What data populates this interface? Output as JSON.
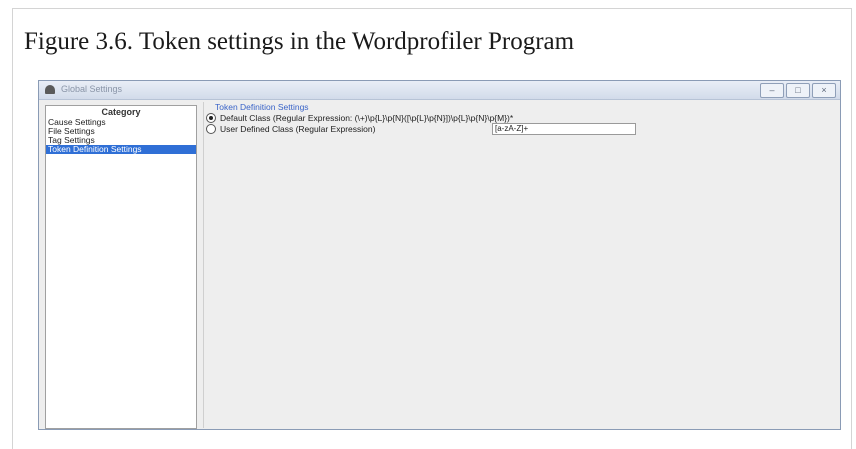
{
  "caption": "Figure 3.6. Token settings in the Wordprofiler Program",
  "window": {
    "title": "Global Settings",
    "buttons": {
      "minimize": "–",
      "maximize": "□",
      "close": "×"
    }
  },
  "category": {
    "header": "Category",
    "items": [
      {
        "label": "Cause Settings",
        "selected": false
      },
      {
        "label": "File Settings",
        "selected": false
      },
      {
        "label": "Tag Settings",
        "selected": false
      },
      {
        "label": "Token Definition Settings",
        "selected": true
      }
    ]
  },
  "token_settings": {
    "group_title": "Token Definition Settings",
    "default_option": {
      "label": "Default Class (Regular Expression: (\\+)\\p{L}\\p{N}([\\p{L}\\p{N}])\\p{L}\\p{N}\\p{M})*",
      "checked": true
    },
    "user_option": {
      "label": "User Defined Class (Regular Expression)",
      "checked": false
    },
    "user_regex_value": "[a-zA-Z]+"
  }
}
